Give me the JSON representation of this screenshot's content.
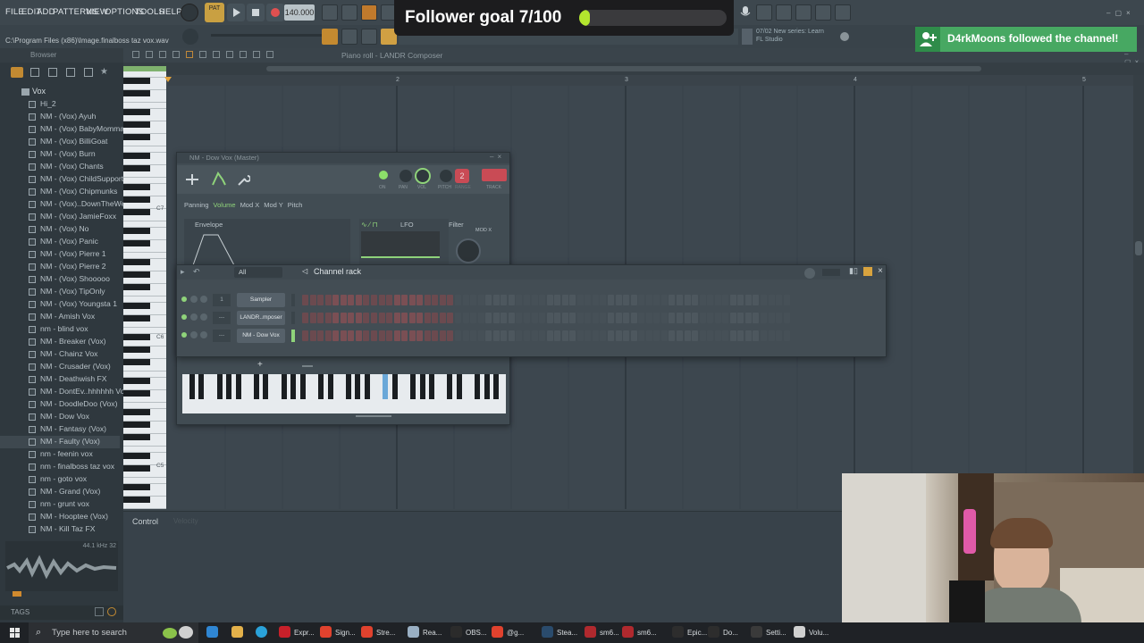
{
  "menu": {
    "items": [
      "FILE",
      "EDIT",
      "ADD",
      "PATTERNS",
      "VIEW",
      "OPTIONS",
      "TOOLS",
      "HELP"
    ]
  },
  "transport": {
    "tempo": "140.000",
    "pat_label": "PAT"
  },
  "hint": {
    "path": "C:\\Program Files (x86)\\Image.finalboss taz vox.wav",
    "info_date": "07/02",
    "info_line1": "New series: Learn",
    "info_line2": "FL Studio"
  },
  "goal": {
    "text": "Follower goal 7/100",
    "progress": 0.07
  },
  "notification": {
    "text": "D4rkMoons followed the channel!"
  },
  "browser": {
    "title": "Browser",
    "folder": "Vox",
    "items": [
      {
        "label": "Hi_2"
      },
      {
        "label": "NM - (Vox) Ayuh"
      },
      {
        "label": "NM - (Vox) BabyMomma"
      },
      {
        "label": "NM - (Vox) BilliGoat"
      },
      {
        "label": "NM - (Vox) Burn"
      },
      {
        "label": "NM - (Vox) Chants"
      },
      {
        "label": "NM - (Vox) ChildSupport"
      },
      {
        "label": "NM - (Vox) Chipmunks"
      },
      {
        "label": "NM - (Vox)..DownTheWell"
      },
      {
        "label": "NM - (Vox) JamieFoxx"
      },
      {
        "label": "NM - (Vox) No"
      },
      {
        "label": "NM - (Vox) Panic"
      },
      {
        "label": "NM - (Vox) Pierre 1"
      },
      {
        "label": "NM - (Vox) Pierre 2"
      },
      {
        "label": "NM - (Vox) Shooooo"
      },
      {
        "label": "NM - (Vox) TipOnly"
      },
      {
        "label": "NM - (Vox) Youngsta 1"
      },
      {
        "label": "NM - Amish Vox"
      },
      {
        "label": "nm - blind vox"
      },
      {
        "label": "NM - Breaker (Vox)"
      },
      {
        "label": "NM - Chainz Vox"
      },
      {
        "label": "NM - Crusader (Vox)"
      },
      {
        "label": "NM - Deathwish FX"
      },
      {
        "label": "NM - DontEv..hhhhhh Vox"
      },
      {
        "label": "NM - DoodleDoo (Vox)"
      },
      {
        "label": "NM - Dow Vox"
      },
      {
        "label": "NM - Fantasy (Vox)"
      },
      {
        "label": "NM - Faulty (Vox)"
      },
      {
        "label": "nm - feenin vox"
      },
      {
        "label": "nm - finalboss taz vox"
      },
      {
        "label": "nm - goto vox"
      },
      {
        "label": "NM - Grand (Vox)"
      },
      {
        "label": "nm - grunt vox"
      },
      {
        "label": "NM - Hooptee (Vox)"
      },
      {
        "label": "NM - Kill Taz FX"
      }
    ],
    "wave_info": "44.1 kHz 32",
    "tags_label": "TAGS"
  },
  "piano_roll": {
    "title": "Piano roll - LANDR Composer",
    "bars": [
      "2",
      "3",
      "4",
      "5"
    ],
    "octaves": [
      "C7",
      "C6",
      "C5"
    ],
    "control_label": "Control",
    "control_sub": "Velocity"
  },
  "sampler": {
    "title": "NM - Dow Vox (Master)",
    "knobs": [
      "ON",
      "PAN",
      "VOL",
      "PITCH",
      "RANGE",
      "TRACK"
    ],
    "range_value": "2",
    "tabs": [
      "Panning",
      "Volume",
      "Mod X",
      "Mod Y",
      "Pitch"
    ],
    "active_tab": "Volume",
    "envelope_label": "Envelope",
    "lfo_label": "LFO",
    "filter_label": "Filter",
    "modx_label": "MOD X"
  },
  "channel_rack": {
    "title": "Channel rack",
    "filter": "All",
    "channels": [
      {
        "num": "1",
        "name": "Sampler"
      },
      {
        "num": "---",
        "name": "LANDR..mposer"
      },
      {
        "num": "---",
        "name": "NM - Dow Vox"
      }
    ],
    "add_label": "+"
  },
  "taskbar": {
    "search_placeholder": "Type here to search",
    "apps": [
      {
        "label": "Expr...",
        "color": "#c8202a"
      },
      {
        "label": "Sign...",
        "color": "#e0422e"
      },
      {
        "label": "Stre...",
        "color": "#e0422e"
      },
      {
        "label": "Rea...",
        "color": "#9ab0c4"
      },
      {
        "label": "OBS...",
        "color": "#2b2b2b"
      },
      {
        "label": "@g...",
        "color": "#e0422e"
      },
      {
        "label": "Stea...",
        "color": "#2a4b6c"
      },
      {
        "label": "sm6...",
        "color": "#b0292e"
      },
      {
        "label": "sm6...",
        "color": "#b0292e"
      },
      {
        "label": "Epic...",
        "color": "#2d2d2d"
      },
      {
        "label": "Do...",
        "color": "#2d2d2d"
      },
      {
        "label": "Setti...",
        "color": "#3a3a3a"
      },
      {
        "label": "Volu...",
        "color": "#d0d0d0"
      }
    ]
  }
}
